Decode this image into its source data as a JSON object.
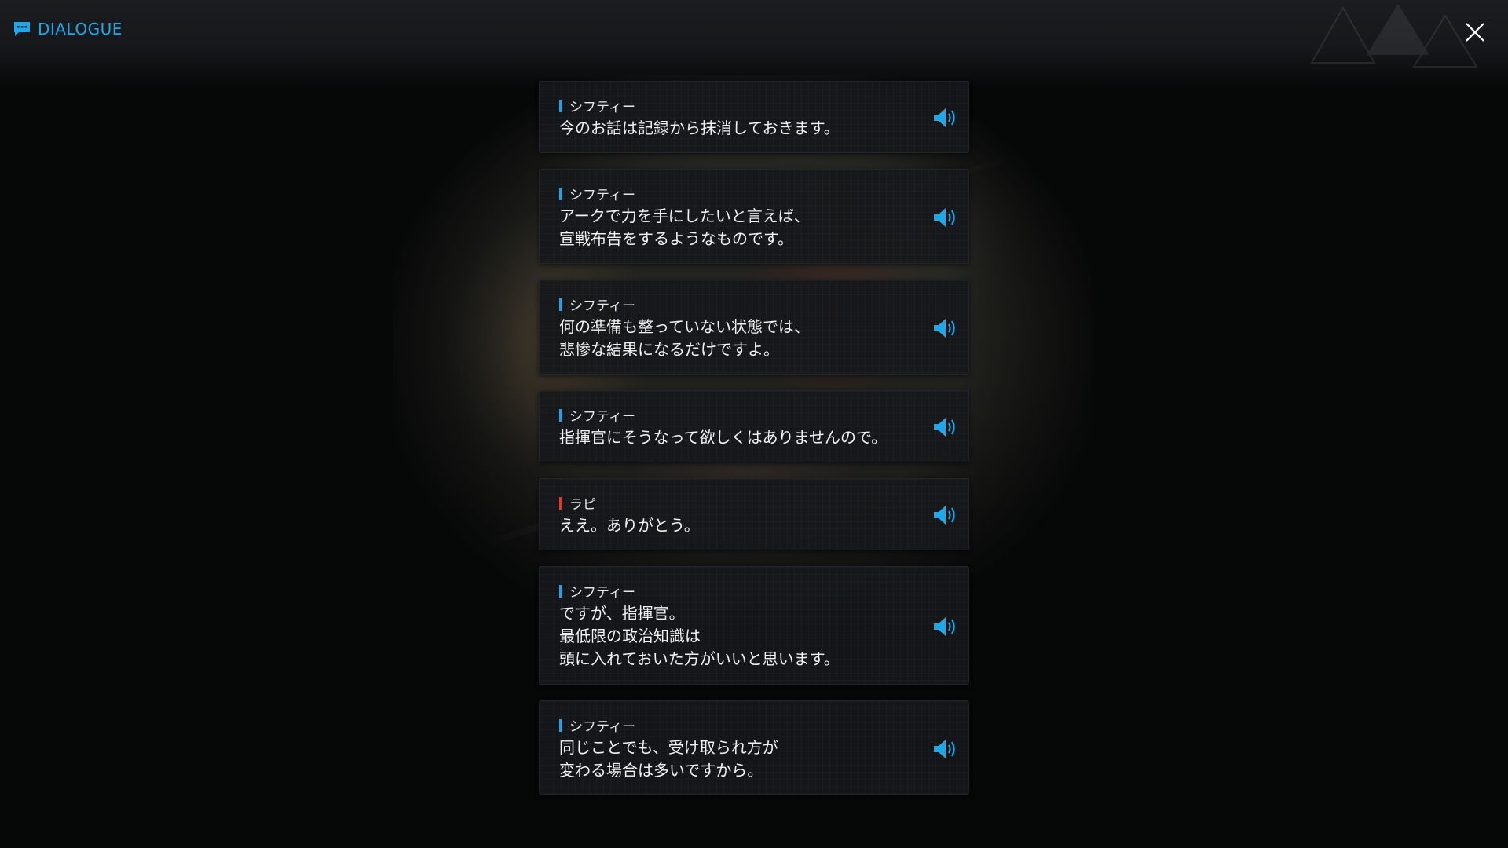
{
  "header": {
    "title": "DIALOGUE",
    "icon": "chat-bubble-icon",
    "close_icon": "close-icon"
  },
  "colors": {
    "accent": "#1da8ea",
    "speaker_marker_default": "#1ea5e8",
    "speaker_marker_alt": "#e03a2a",
    "card_background": "#16181b",
    "text": "#f2f2f2"
  },
  "dialogue": [
    {
      "speaker": "シフティー",
      "text": "今のお話は記録から抹消しておきます。",
      "marker": "blue",
      "voice_icon": "speaker-volume-icon"
    },
    {
      "speaker": "シフティー",
      "text": "アークで力を手にしたいと言えば、\n宣戦布告をするようなものです。",
      "marker": "blue",
      "voice_icon": "speaker-volume-icon"
    },
    {
      "speaker": "シフティー",
      "text": "何の準備も整っていない状態では、\n悲惨な結果になるだけですよ。",
      "marker": "blue",
      "voice_icon": "speaker-volume-icon"
    },
    {
      "speaker": "シフティー",
      "text": "指揮官にそうなって欲しくはありませんので。",
      "marker": "blue",
      "voice_icon": "speaker-volume-icon"
    },
    {
      "speaker": "ラピ",
      "text": "ええ。ありがとう。",
      "marker": "red",
      "voice_icon": "speaker-volume-icon"
    },
    {
      "speaker": "シフティー",
      "text": "ですが、指揮官。\n最低限の政治知識は\n頭に入れておいた方がいいと思います。",
      "marker": "blue",
      "voice_icon": "speaker-volume-icon"
    },
    {
      "speaker": "シフティー",
      "text": "同じことでも、受け取られ方が\n変わる場合は多いですから。",
      "marker": "blue",
      "voice_icon": "speaker-volume-icon"
    }
  ]
}
